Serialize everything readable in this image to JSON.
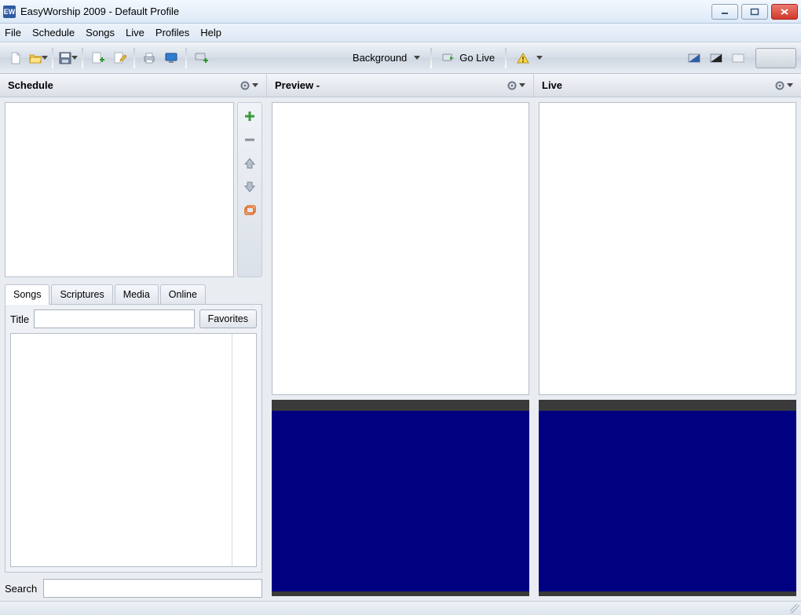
{
  "titlebar": {
    "app_icon_text": "EW",
    "title": "EasyWorship 2009 - Default Profile"
  },
  "menubar": [
    "File",
    "Schedule",
    "Songs",
    "Live",
    "Profiles",
    "Help"
  ],
  "toolbar": {
    "background_label": "Background",
    "golive_label": "Go Live"
  },
  "panels": {
    "schedule_title": "Schedule",
    "preview_title": "Preview -",
    "live_title": "Live"
  },
  "tabs": [
    "Songs",
    "Scriptures",
    "Media",
    "Online"
  ],
  "songs_panel": {
    "title_label": "Title",
    "favorites_label": "Favorites",
    "search_label": "Search"
  }
}
